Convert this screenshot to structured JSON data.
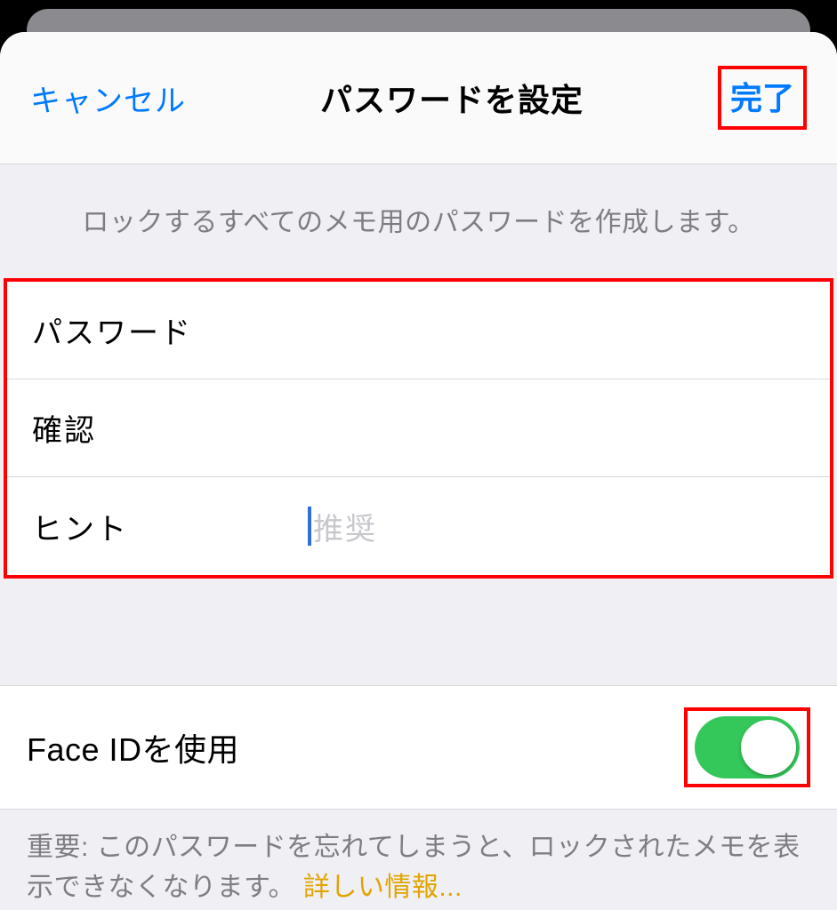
{
  "navbar": {
    "cancel": "キャンセル",
    "title": "パスワードを設定",
    "done": "完了"
  },
  "description": "ロックするすべてのメモ用のパスワードを作成します。",
  "fields": {
    "password_label": "パスワード",
    "password_value": "",
    "confirm_label": "確認",
    "confirm_value": "",
    "hint_label": "ヒント",
    "hint_value": "",
    "hint_placeholder": "推奨"
  },
  "faceid": {
    "label": "Face IDを使用",
    "enabled": true
  },
  "footer": {
    "note_prefix": "重要: このパスワードを忘れてしまうと、ロックされたメモを表示できなくなります。",
    "link": "詳しい情報..."
  },
  "colors": {
    "accent": "#007aff",
    "toggle_on": "#34c759",
    "highlight_border": "#ff0000",
    "link": "#e1a400"
  }
}
